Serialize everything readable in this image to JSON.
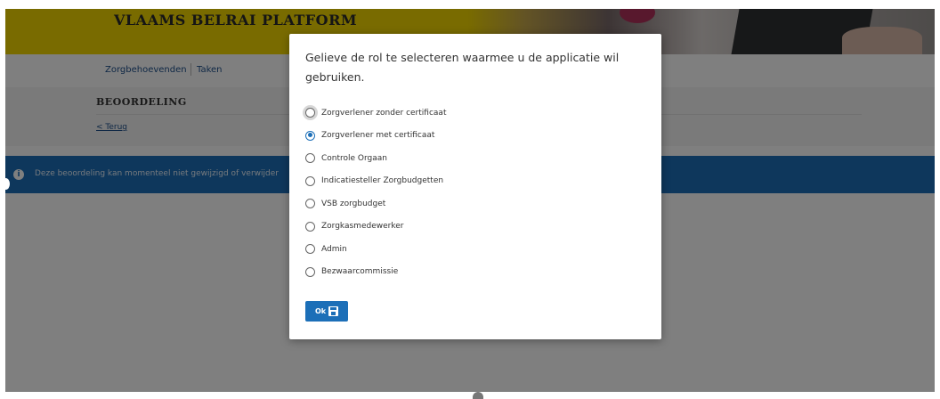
{
  "header": {
    "platform_title": "VLAAMS BELRAI PLATFORM"
  },
  "nav": {
    "items": [
      {
        "label": "Zorgbehoevenden"
      },
      {
        "label": "Taken"
      }
    ]
  },
  "page": {
    "title": "BEOORDELING",
    "back_link": "< Terug"
  },
  "banner": {
    "icon": "info-icon",
    "message": "Deze beoordeling kan momenteel niet gewijzigd of verwijder"
  },
  "modal": {
    "title": "Gelieve de rol te selecteren waarmee u de applicatie wil gebruiken.",
    "options": [
      {
        "label": "Zorgverlener zonder certificaat",
        "checked": false
      },
      {
        "label": "Zorgverlener met certificaat",
        "checked": true
      },
      {
        "label": "Controle Orgaan",
        "checked": false
      },
      {
        "label": "Indicatiesteller Zorgbudgetten",
        "checked": false
      },
      {
        "label": "VSB zorgbudget",
        "checked": false
      },
      {
        "label": "Zorgkasmedewerker",
        "checked": false
      },
      {
        "label": "Admin",
        "checked": false
      },
      {
        "label": "Bezwaarcommissie",
        "checked": false
      }
    ],
    "ok_label": "Ok",
    "ok_icon": "save-icon"
  },
  "colors": {
    "brand_yellow": "#f2d600",
    "primary_blue": "#1c6fb8"
  }
}
